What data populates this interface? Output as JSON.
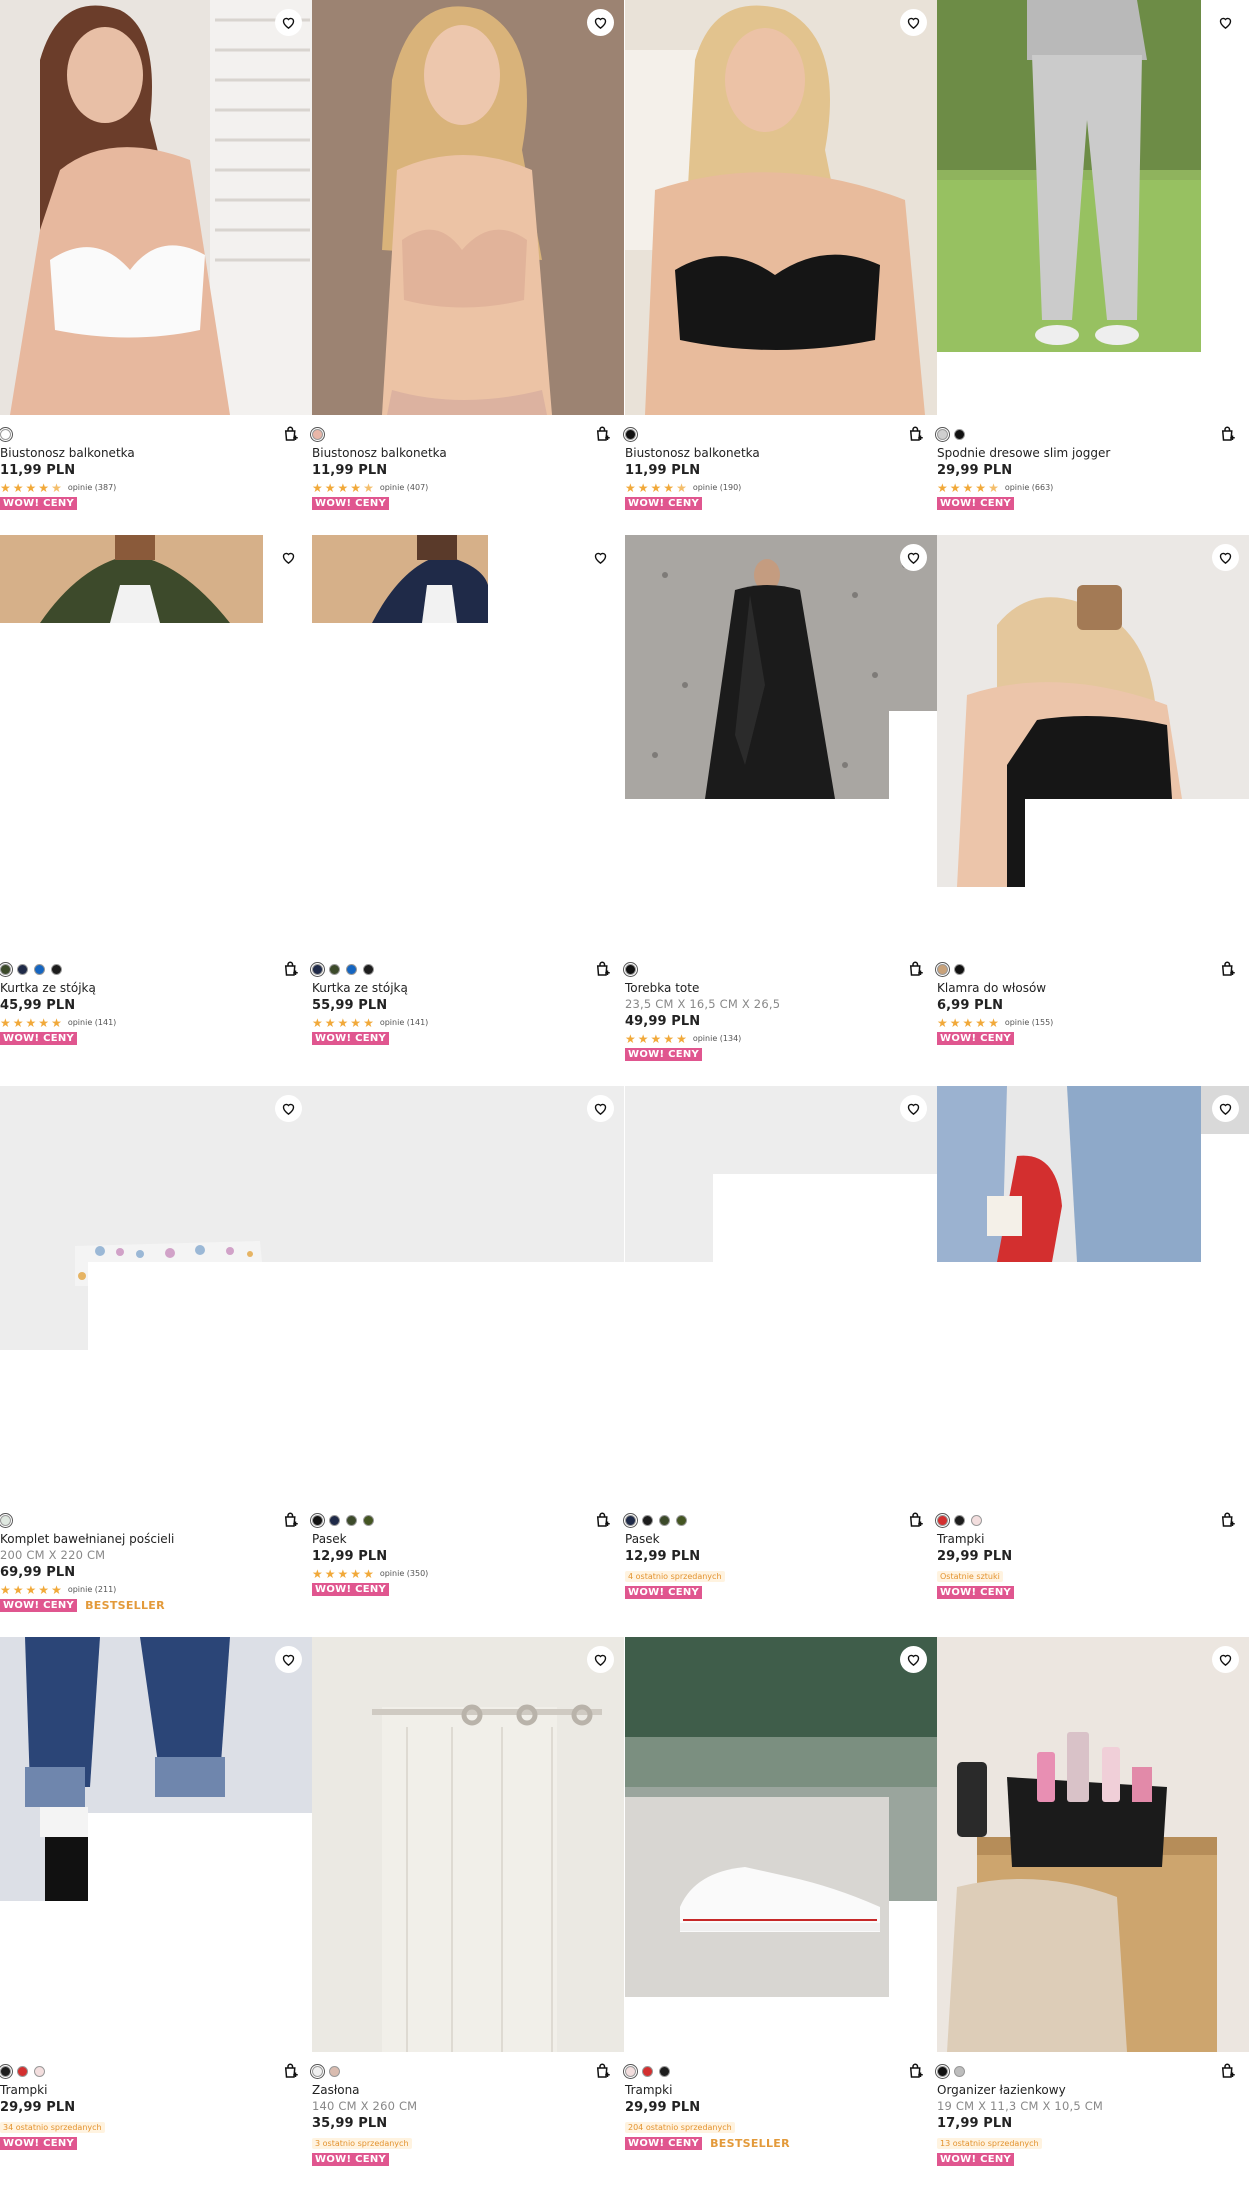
{
  "labels": {
    "wow": "WOW! CENY",
    "bestseller": "BESTSELLER"
  },
  "colors": {
    "wow_badge": "#e0568f",
    "star": "#f1a93a",
    "bestseller": "#e39a3a"
  },
  "products": [
    {
      "name": "Biustonosz balkonetka",
      "price": "11,99 PLN",
      "reviews": "opinie (387)",
      "stars": 4.5,
      "swatches": [
        "#ffffff"
      ]
    },
    {
      "name": "Biustonosz balkonetka",
      "price": "11,99 PLN",
      "reviews": "opinie (407)",
      "stars": 4.5,
      "swatches": [
        "#e8b6a8"
      ]
    },
    {
      "name": "Biustonosz balkonetka",
      "price": "11,99 PLN",
      "reviews": "opinie (190)",
      "stars": 4.5,
      "swatches": [
        "#111111"
      ]
    },
    {
      "name": "Spodnie dresowe slim jogger",
      "price": "29,99 PLN",
      "reviews": "opinie (663)",
      "stars": 4.5,
      "swatches": [
        "#cfcfcf",
        "#111111"
      ]
    },
    {
      "name": "Kurtka ze stójką",
      "price": "45,99 PLN",
      "reviews": "opinie (141)",
      "stars": 5,
      "swatches": [
        "#3c4a2a",
        "#1f2a48",
        "#1565c0",
        "#1d1d1d"
      ]
    },
    {
      "name": "Kurtka ze stójką",
      "price": "55,99 PLN",
      "reviews": "opinie (141)",
      "stars": 5,
      "swatches": [
        "#1f2a48",
        "#3c4a2a",
        "#1565c0",
        "#1d1d1d"
      ]
    },
    {
      "name": "Torebka tote",
      "dims": "23,5 CM X 16,5 CM X 26,5",
      "price": "49,99 PLN",
      "reviews": "opinie (134)",
      "stars": 5,
      "swatches": [
        "#111111"
      ]
    },
    {
      "name": "Klamra do włosów",
      "price": "6,99 PLN",
      "reviews": "opinie (155)",
      "stars": 5,
      "swatches": [
        "#c9a27a",
        "#111111"
      ]
    },
    {
      "name": "Komplet bawełnianej pościeli",
      "dims": "200 CM X 220 CM",
      "price": "69,99 PLN",
      "reviews": "opinie (211)",
      "stars": 5,
      "swatches": [
        "#dfe8e0"
      ],
      "bestseller": true
    },
    {
      "name": "Pasek",
      "price": "12,99 PLN",
      "reviews": "opinie (350)",
      "stars": 5,
      "swatches": [
        "#111111",
        "#1f2a48",
        "#3c4a2a",
        "#445522"
      ]
    },
    {
      "name": "Pasek",
      "price": "12,99 PLN",
      "badge": "4 ostatnio sprzedanych",
      "swatches": [
        "#1f2a48",
        "#1d1d1d",
        "#3c4a2a",
        "#445522"
      ]
    },
    {
      "name": "Trampki",
      "price": "29,99 PLN",
      "badge": "Ostatnie sztuki",
      "swatches": [
        "#d32f2f",
        "#1d1d1d",
        "#f3dede"
      ]
    },
    {
      "name": "Trampki",
      "price": "29,99 PLN",
      "badge": "34 ostatnio sprzedanych",
      "swatches": [
        "#1d1d1d",
        "#d32f2f",
        "#f3dede"
      ]
    },
    {
      "name": "Zasłona",
      "dims": "140 CM X 260 CM",
      "price": "35,99 PLN",
      "badge": "3 ostatnio sprzedanych",
      "swatches": [
        "#f0f0f0",
        "#d9bcb0"
      ]
    },
    {
      "name": "Trampki",
      "price": "29,99 PLN",
      "badge": "204 ostatnio sprzedanych",
      "swatches": [
        "#f3dede",
        "#d32f2f",
        "#1d1d1d"
      ],
      "bestseller": true
    },
    {
      "name": "Organizer łazienkowy",
      "dims": "19 CM X 11,3 CM X 10,5 CM",
      "price": "17,99 PLN",
      "badge": "13 ostatnio sprzedanych",
      "swatches": [
        "#111111",
        "#bdbdbd"
      ]
    }
  ]
}
